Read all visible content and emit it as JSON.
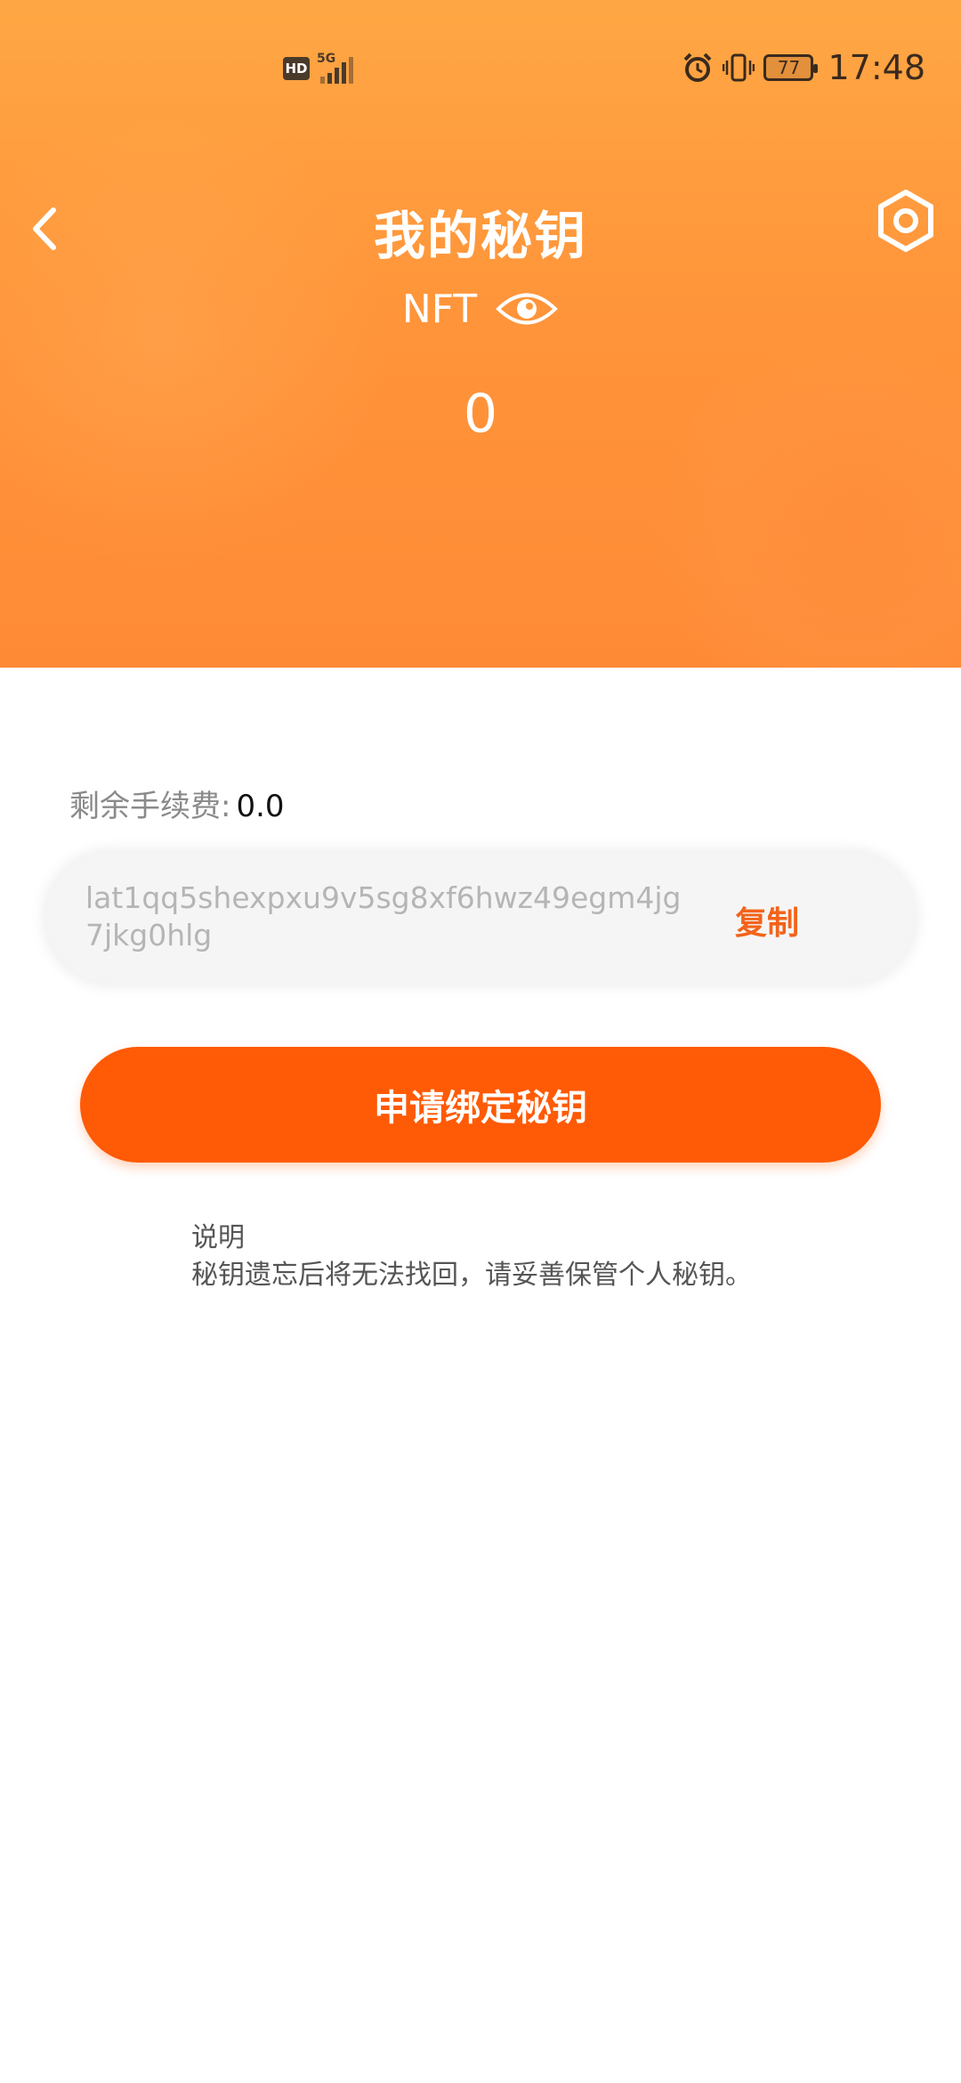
{
  "status_bar": {
    "hd_label": "HD",
    "network": "5G",
    "battery": "77",
    "time": "17:48"
  },
  "header": {
    "title": "我的秘钥",
    "asset_label": "NFT",
    "balance": "0"
  },
  "fee": {
    "label": "剩余手续费:",
    "value": "0.0"
  },
  "key": {
    "address": "lat1qq5shexpxu9v5sg8xf6hwz49egm4jg7jkg0hlg",
    "copy_label": "复制"
  },
  "actions": {
    "bind_label": "申请绑定秘钥"
  },
  "note": {
    "title": "说明",
    "text": "秘钥遗忘后将无法找回，请妥善保管个人秘钥。"
  },
  "colors": {
    "accent": "#FF5A05",
    "copy": "#F3631A",
    "header_top": "#FFA744",
    "header_bottom": "#FF8A36"
  }
}
